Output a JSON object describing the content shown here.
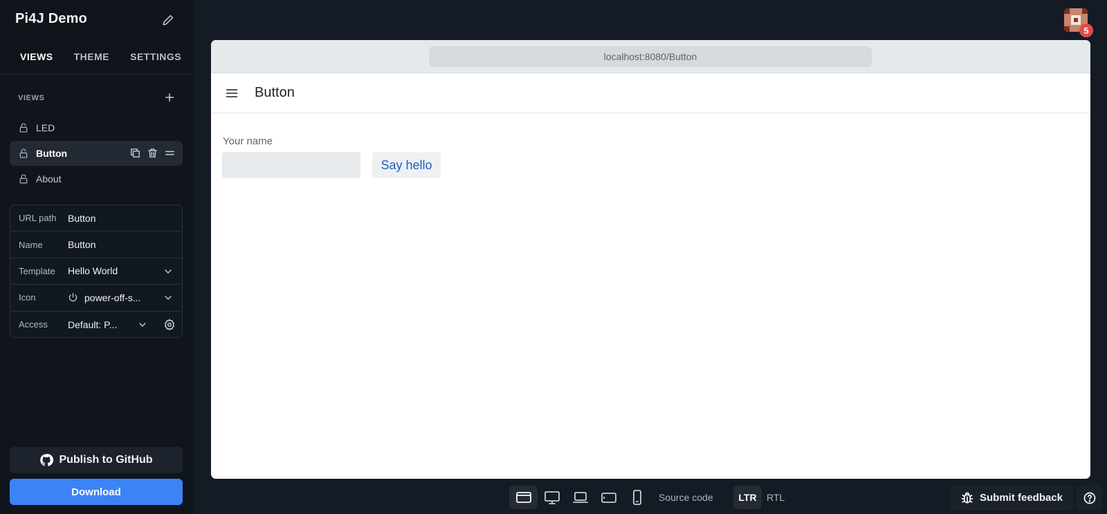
{
  "app": {
    "title": "Pi4J Demo"
  },
  "nav": {
    "tabs": [
      {
        "label": "VIEWS"
      },
      {
        "label": "THEME"
      },
      {
        "label": "SETTINGS"
      }
    ]
  },
  "views": {
    "heading": "VIEWS",
    "items": [
      {
        "label": "LED"
      },
      {
        "label": "Button"
      },
      {
        "label": "About"
      }
    ]
  },
  "properties": {
    "url_path": {
      "label": "URL path",
      "value": "Button"
    },
    "name": {
      "label": "Name",
      "value": "Button"
    },
    "template": {
      "label": "Template",
      "value": "Hello World"
    },
    "icon": {
      "label": "Icon",
      "value": "power-off-s..."
    },
    "access": {
      "label": "Access",
      "value": "Default: P..."
    }
  },
  "buttons": {
    "publish": "Publish to GitHub",
    "download": "Download"
  },
  "user": {
    "notification_count": "5"
  },
  "preview": {
    "url": "localhost:8080/Button",
    "page_title": "Button",
    "field_label": "Your name",
    "field_value": "",
    "say_hello": "Say hello"
  },
  "toolbar": {
    "devices": [
      "responsive-icon",
      "desktop-icon",
      "laptop-icon",
      "tablet-icon",
      "phone-icon"
    ],
    "source_code": "Source code",
    "ltr": "LTR",
    "rtl": "RTL",
    "feedback": "Submit feedback"
  },
  "colors": {
    "accent": "#3b83f6",
    "badge": "#e5484d",
    "link": "#1e5fc4",
    "sidebar_bg": "#10151c"
  }
}
